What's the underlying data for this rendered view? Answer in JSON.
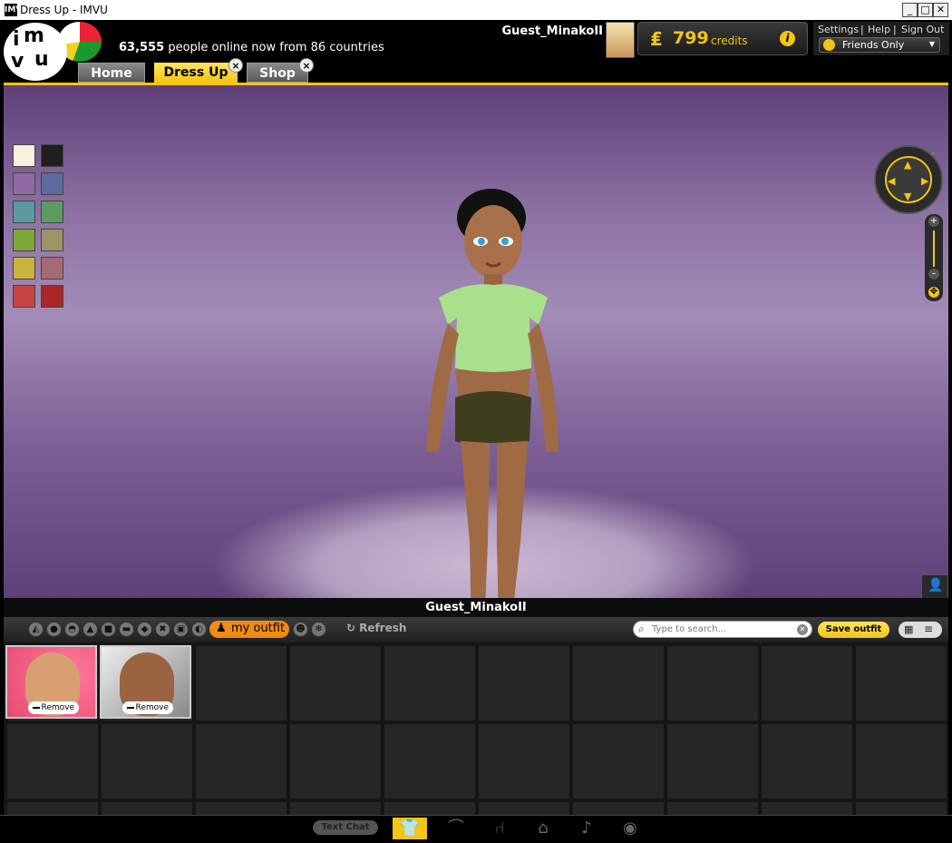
{
  "window": {
    "title": "Dress Up - IMVU",
    "app_icon": "IMVU",
    "min": "_",
    "max": "□",
    "close": "✕"
  },
  "header": {
    "logo": "imvu",
    "online_count": "63,555",
    "online_text": "people online now from 86 countries",
    "username": "Guest_MinakoII",
    "credits_symbol": "₤",
    "credits_amount": "799",
    "credits_label": "credits",
    "info_glyph": "i",
    "links": {
      "settings": "Settings",
      "help": "Help",
      "sign_out": "Sign Out",
      "sep": "|"
    },
    "status_dropdown": "Friends Only"
  },
  "tabs": [
    {
      "label": "Home",
      "active": false
    },
    {
      "label": "Dress Up",
      "active": true
    },
    {
      "label": "Shop",
      "active": false
    }
  ],
  "tab_close_glyph": "×",
  "viewport": {
    "swatches": [
      "#f8f1e0",
      "#1e1e1e",
      "#8f6aa6",
      "#5c6aa0",
      "#5e98a0",
      "#5e9a62",
      "#7ea63a",
      "#9c9466",
      "#c8b33e",
      "#a66a74",
      "#c84444",
      "#a82828"
    ],
    "nav_arrows": {
      "up": "▲",
      "down": "▼",
      "left": "◀",
      "right": "▶",
      "minus": "–"
    },
    "zoom": {
      "plus": "+",
      "minus": "–",
      "fit": "✥"
    },
    "avatar_name": "Guest_MinakoII",
    "camera_icon": "👤"
  },
  "toolbar": {
    "categories": [
      "◭",
      "●",
      "◓",
      "▲",
      "■",
      "▬",
      "◆",
      "✖",
      "▣",
      "◐"
    ],
    "my_outfit_label": "my outfit",
    "my_outfit_icon": "♟",
    "extra_icons": [
      "☻",
      "❄"
    ],
    "refresh_label": "Refresh",
    "refresh_icon": "↻",
    "search_icon": "⌕",
    "search_placeholder": "Type to search...",
    "clear_icon": "✕",
    "save_outfit_label": "Save outfit",
    "view_grid": "▦",
    "view_list": "≡"
  },
  "outfit_items": [
    {
      "remove_label": "Remove"
    },
    {
      "remove_label": "Remove"
    }
  ],
  "bottom_bar": {
    "text_chat_label": "Text Chat",
    "icons": [
      "👕",
      "⌒",
      "⑁",
      "⌂",
      "♪",
      "◉"
    ]
  }
}
